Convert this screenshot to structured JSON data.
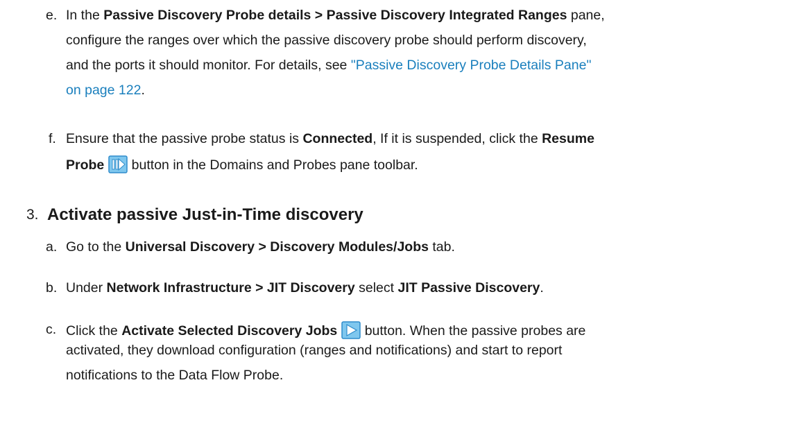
{
  "e": {
    "label": "e.",
    "t1": "In the ",
    "b1": "Passive Discovery Probe details > Passive Discovery Integrated Ranges",
    "t2": " pane,",
    "line2": "configure the ranges over which the passive discovery probe should perform discovery,",
    "line3_text": "and the ports it should monitor. For details, see ",
    "link_part1": "\"Passive Discovery Probe Details Pane\"",
    "link_part2": "on page 122",
    "end": "."
  },
  "f": {
    "label": "f.",
    "t1": "Ensure that the passive probe status is ",
    "b1": "Connected",
    "t2": ", If it is suspended, click the ",
    "b2": "Resume",
    "b3": "Probe",
    "t3": " button in the Domains and Probes pane toolbar."
  },
  "step3": {
    "number": "3.",
    "heading": "Activate passive Just-in-Time discovery"
  },
  "a": {
    "label": "a.",
    "t1": "Go to the ",
    "b1": "Universal Discovery > Discovery Modules/Jobs",
    "t2": " tab."
  },
  "b": {
    "label": "b.",
    "t1": "Under ",
    "b1": "Network Infrastructure > JIT Discovery",
    "t2": " select ",
    "b2": "JIT Passive Discovery",
    "t3": "."
  },
  "c": {
    "label": "c.",
    "t1": "Click the ",
    "b1": "Activate Selected Discovery Jobs",
    "t2": " button. When the passive probes are",
    "line2": "activated, they download configuration (ranges and notifications) and start to report",
    "line3": "notifications to the Data Flow Probe."
  },
  "icons": [
    "resume-probe-icon",
    "activate-jobs-icon"
  ]
}
